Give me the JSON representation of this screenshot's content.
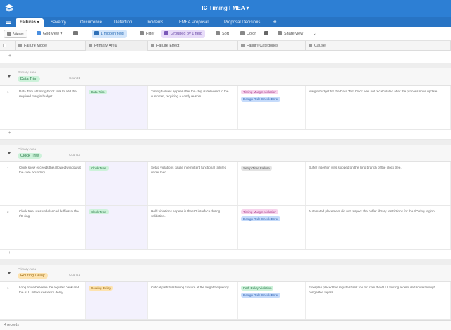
{
  "header": {
    "title": "IC Timing FMEA"
  },
  "tabs": [
    {
      "label": "Failures",
      "active": true
    },
    {
      "label": "Severity"
    },
    {
      "label": "Occurrence"
    },
    {
      "label": "Detection"
    },
    {
      "label": "Incidents"
    },
    {
      "label": "FMEA Proposal"
    },
    {
      "label": "Proposal Decisions"
    }
  ],
  "toolbar": {
    "views_label": "Views",
    "grid_label": "Grid view",
    "hidden_label": "1 hidden field",
    "filter_label": "Filter",
    "group_label": "Grouped by 1 field",
    "sort_label": "Sort",
    "color_label": "Color",
    "share_label": "Share view"
  },
  "columns": [
    "Failure Mode",
    "Primary Area",
    "Failure Effect",
    "Failure Categories",
    "Cause"
  ],
  "groups": [
    {
      "field": "Primary Area",
      "value": "Data Trim",
      "pill_bg": "#cdf2da",
      "pill_fg": "#2a7a4a",
      "count": "Count 1",
      "rows": [
        {
          "num": "1",
          "failure_mode": "Data Trim at timing block fails to add the required margin budget.",
          "area": "Data Trim",
          "effect": "Timing failures appear after the chip is delivered to the customer, requiring a costly re-spin.",
          "categories": [
            {
              "label": "Timing Margin Violation",
              "bg": "#f7d3ec",
              "fg": "#a43c8a"
            },
            {
              "label": "Design Rule Check Error",
              "bg": "#c5dbfb",
              "fg": "#2d61b0"
            }
          ],
          "cause": "Margin budget for the Data Trim block was not recalculated after the process node update."
        }
      ]
    },
    {
      "field": "Primary Area",
      "value": "Clock Tree",
      "pill_bg": "#cdf2da",
      "pill_fg": "#2a7a4a",
      "count": "Count 2",
      "rows": [
        {
          "num": "1",
          "failure_mode": "Clock skew exceeds the allowed window at the core boundary.",
          "area": "Clock Tree",
          "effect": "Setup violations cause intermittent functional failures under load.",
          "categories": [
            {
              "label": "Setup Time Failure",
              "bg": "#e3e3e3",
              "fg": "#555555"
            }
          ],
          "cause": "Buffer insertion was skipped on the long branch of the clock tree."
        },
        {
          "num": "2",
          "failure_mode": "Clock tree uses unbalanced buffers at the I/O ring.",
          "area": "Clock Tree",
          "effect": "Hold violations appear in the I/O interface during validation.",
          "categories": [
            {
              "label": "Timing Margin Violation",
              "bg": "#f7d3ec",
              "fg": "#a43c8a"
            },
            {
              "label": "Design Rule Check Error",
              "bg": "#c5dbfb",
              "fg": "#2d61b0"
            }
          ],
          "cause": "Automated placement did not respect the buffer library restrictions for the I/O ring region."
        }
      ]
    },
    {
      "field": "Primary Area",
      "value": "Routing Delay",
      "pill_bg": "#fde3b0",
      "pill_fg": "#9a6a12",
      "count": "Count 1",
      "rows": [
        {
          "num": "1",
          "failure_mode": "Long route between the register bank and the ALU introduces extra delay.",
          "area": "Routing Delay",
          "effect": "Critical path fails timing closure at the target frequency.",
          "categories": [
            {
              "label": "Path Delay Violation",
              "bg": "#cdf2da",
              "fg": "#2a7a4a"
            },
            {
              "label": "Design Rule Check Error",
              "bg": "#c5dbfb",
              "fg": "#2d61b0"
            }
          ],
          "cause": "Floorplan placed the register bank too far from the ALU, forcing a detoured route through congested layers."
        }
      ]
    }
  ],
  "footer": {
    "records": "4 records"
  },
  "colors": {
    "brand": "#2d7fd4",
    "tabbar": "#2874c4"
  }
}
